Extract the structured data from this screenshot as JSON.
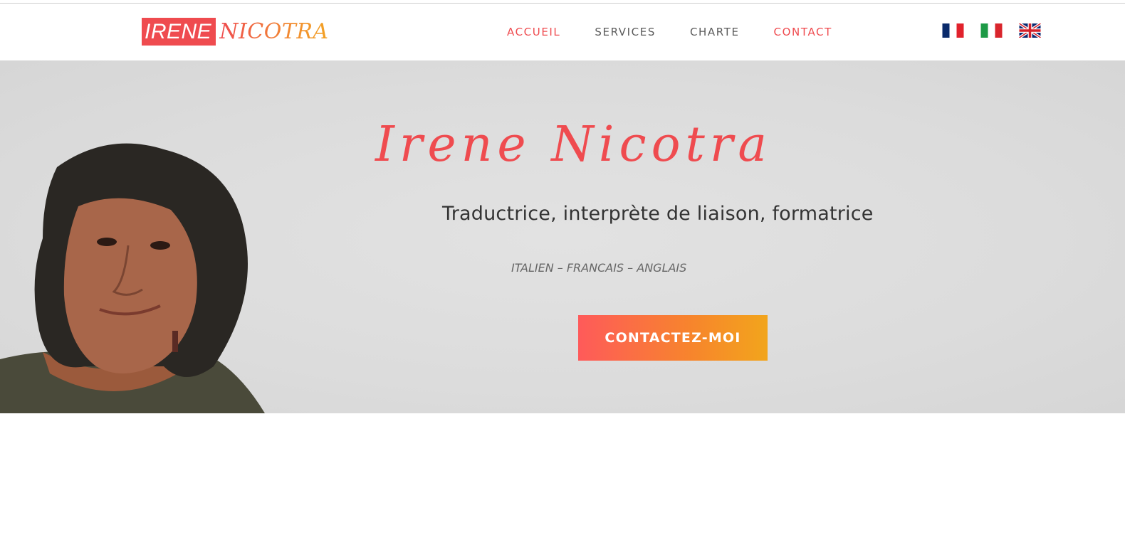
{
  "header": {
    "logo_box": "IRENE",
    "logo_text": "NICOTRA",
    "nav": [
      {
        "label": "ACCUEIL",
        "active": true
      },
      {
        "label": "SERVICES",
        "active": false
      },
      {
        "label": "CHARTE",
        "active": false
      },
      {
        "label": "CONTACT",
        "active": true
      }
    ],
    "flags": [
      "france-flag-icon",
      "italy-flag-icon",
      "uk-flag-icon"
    ]
  },
  "hero": {
    "title": "Irene Nicotra",
    "subtitle": "Traductrice, interprète de liaison, formatrice",
    "languages": "ITALIEN – FRANCAIS – ANGLAIS",
    "cta_label": "CONTACTEZ-MOI"
  },
  "colors": {
    "accent": "#ef4b4f",
    "nav_text": "#5b5b5b",
    "cta_start": "#fe5a5a",
    "cta_end": "#f2a51c"
  }
}
